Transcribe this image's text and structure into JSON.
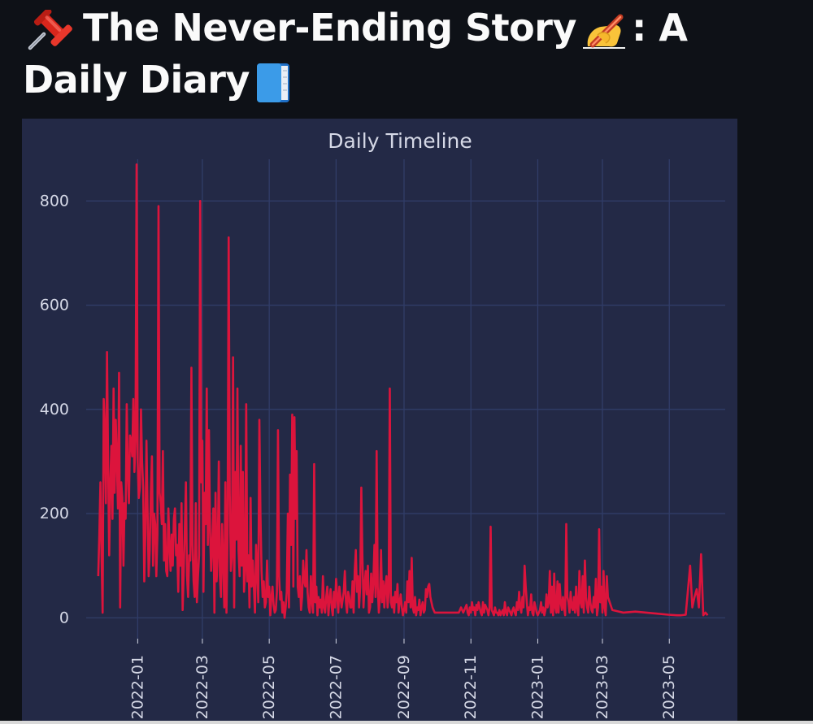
{
  "page": {
    "title_part1": "The Never-Ending Story",
    "title_part2": ": A",
    "title_part3": "Daily Diary",
    "icons": [
      "pushpin-icon",
      "writing-hand-icon",
      "blue-book-icon"
    ]
  },
  "chart_data": {
    "type": "line",
    "title": "Daily Timeline",
    "xlabel": "",
    "ylabel": "",
    "color": "#dc143c",
    "grid": true,
    "background": "#232946",
    "gridcolor": "#313d68",
    "ylim": [
      -40,
      880
    ],
    "xlim": [
      "2021-11-15",
      "2023-06-21"
    ],
    "yticks": [
      0,
      200,
      400,
      600,
      800
    ],
    "xticks": [
      "2022-01",
      "2022-03",
      "2022-05",
      "2022-07",
      "2022-09",
      "2022-11",
      "2023-01",
      "2023-03",
      "2023-05"
    ],
    "x": [
      "2021-11-26",
      "2021-11-27",
      "2021-11-28",
      "2021-11-29",
      "2021-11-30",
      "2021-12-01",
      "2021-12-02",
      "2021-12-03",
      "2021-12-04",
      "2021-12-05",
      "2021-12-06",
      "2021-12-07",
      "2021-12-08",
      "2021-12-09",
      "2021-12-10",
      "2021-12-11",
      "2021-12-12",
      "2021-12-13",
      "2021-12-14",
      "2021-12-15",
      "2021-12-16",
      "2021-12-17",
      "2021-12-18",
      "2021-12-19",
      "2021-12-20",
      "2021-12-21",
      "2021-12-22",
      "2021-12-23",
      "2021-12-24",
      "2021-12-25",
      "2021-12-26",
      "2021-12-27",
      "2021-12-28",
      "2021-12-29",
      "2021-12-30",
      "2021-12-31",
      "2022-01-01",
      "2022-01-02",
      "2022-01-03",
      "2022-01-04",
      "2022-01-05",
      "2022-01-06",
      "2022-01-07",
      "2022-01-08",
      "2022-01-09",
      "2022-01-10",
      "2022-01-11",
      "2022-01-12",
      "2022-01-13",
      "2022-01-14",
      "2022-01-15",
      "2022-01-16",
      "2022-01-17",
      "2022-01-18",
      "2022-01-19",
      "2022-01-20",
      "2022-01-21",
      "2022-01-22",
      "2022-01-23",
      "2022-01-24",
      "2022-01-25",
      "2022-01-26",
      "2022-01-27",
      "2022-01-28",
      "2022-01-29",
      "2022-01-30",
      "2022-01-31",
      "2022-02-01",
      "2022-02-02",
      "2022-02-03",
      "2022-02-04",
      "2022-02-05",
      "2022-02-06",
      "2022-02-07",
      "2022-02-08",
      "2022-02-09",
      "2022-02-10",
      "2022-02-11",
      "2022-02-12",
      "2022-02-13",
      "2022-02-14",
      "2022-02-15",
      "2022-02-16",
      "2022-02-17",
      "2022-02-18",
      "2022-02-19",
      "2022-02-20",
      "2022-02-21",
      "2022-02-22",
      "2022-02-23",
      "2022-02-24",
      "2022-02-25",
      "2022-02-26",
      "2022-02-27",
      "2022-02-28",
      "2022-03-01",
      "2022-03-02",
      "2022-03-03",
      "2022-03-04",
      "2022-03-05",
      "2022-03-06",
      "2022-03-07",
      "2022-03-08",
      "2022-03-09",
      "2022-03-10",
      "2022-03-11",
      "2022-03-12",
      "2022-03-13",
      "2022-03-14",
      "2022-03-15",
      "2022-03-16",
      "2022-03-17",
      "2022-03-18",
      "2022-03-19",
      "2022-03-20",
      "2022-03-21",
      "2022-03-22",
      "2022-03-23",
      "2022-03-24",
      "2022-03-25",
      "2022-03-26",
      "2022-03-27",
      "2022-03-28",
      "2022-03-29",
      "2022-03-30",
      "2022-03-31",
      "2022-04-01",
      "2022-04-02",
      "2022-04-03",
      "2022-04-04",
      "2022-04-05",
      "2022-04-06",
      "2022-04-07",
      "2022-04-08",
      "2022-04-09",
      "2022-04-10",
      "2022-04-11",
      "2022-04-12",
      "2022-04-13",
      "2022-04-14",
      "2022-04-15",
      "2022-04-16",
      "2022-04-17",
      "2022-04-18",
      "2022-04-19",
      "2022-04-20",
      "2022-04-21",
      "2022-04-22",
      "2022-04-23",
      "2022-04-24",
      "2022-04-25",
      "2022-04-26",
      "2022-04-27",
      "2022-04-28",
      "2022-04-29",
      "2022-04-30",
      "2022-05-01",
      "2022-05-02",
      "2022-05-03",
      "2022-05-04",
      "2022-05-05",
      "2022-05-06",
      "2022-05-07",
      "2022-05-08",
      "2022-05-09",
      "2022-05-10",
      "2022-05-11",
      "2022-05-12",
      "2022-05-13",
      "2022-05-14",
      "2022-05-15",
      "2022-05-16",
      "2022-05-17",
      "2022-05-18",
      "2022-05-19",
      "2022-05-20",
      "2022-05-21",
      "2022-05-22",
      "2022-05-23",
      "2022-05-24",
      "2022-05-25",
      "2022-05-26",
      "2022-05-27",
      "2022-05-28",
      "2022-05-29",
      "2022-05-30",
      "2022-05-31",
      "2022-06-01",
      "2022-06-02",
      "2022-06-03",
      "2022-06-04",
      "2022-06-05",
      "2022-06-06",
      "2022-06-07",
      "2022-06-08",
      "2022-06-09",
      "2022-06-10",
      "2022-06-11",
      "2022-06-12",
      "2022-06-13",
      "2022-06-14",
      "2022-06-15",
      "2022-06-16",
      "2022-06-17",
      "2022-06-18",
      "2022-06-19",
      "2022-06-20",
      "2022-06-21",
      "2022-06-22",
      "2022-06-23",
      "2022-06-24",
      "2022-06-25",
      "2022-06-26",
      "2022-06-27",
      "2022-06-28",
      "2022-06-29",
      "2022-06-30",
      "2022-07-01",
      "2022-07-02",
      "2022-07-03",
      "2022-07-04",
      "2022-07-05",
      "2022-07-06",
      "2022-07-07",
      "2022-07-08",
      "2022-07-09",
      "2022-07-10",
      "2022-07-11",
      "2022-07-12",
      "2022-07-13",
      "2022-07-14",
      "2022-07-15",
      "2022-07-16",
      "2022-07-17",
      "2022-07-18",
      "2022-07-19",
      "2022-07-20",
      "2022-07-21",
      "2022-07-22",
      "2022-07-23",
      "2022-07-24",
      "2022-07-25",
      "2022-07-26",
      "2022-07-27",
      "2022-07-28",
      "2022-07-29",
      "2022-07-30",
      "2022-07-31",
      "2022-08-01",
      "2022-08-02",
      "2022-08-03",
      "2022-08-04",
      "2022-08-05",
      "2022-08-06",
      "2022-08-07",
      "2022-08-08",
      "2022-08-09",
      "2022-08-10",
      "2022-08-11",
      "2022-08-12",
      "2022-08-13",
      "2022-08-14",
      "2022-08-15",
      "2022-08-16",
      "2022-08-17",
      "2022-08-18",
      "2022-08-19",
      "2022-08-20",
      "2022-08-21",
      "2022-08-22",
      "2022-08-23",
      "2022-08-24",
      "2022-08-25",
      "2022-08-26",
      "2022-08-27",
      "2022-08-28",
      "2022-08-29",
      "2022-08-30",
      "2022-08-31",
      "2022-09-01",
      "2022-09-02",
      "2022-09-03",
      "2022-09-04",
      "2022-09-05",
      "2022-09-06",
      "2022-09-07",
      "2022-09-08",
      "2022-09-09",
      "2022-09-10",
      "2022-09-11",
      "2022-09-12",
      "2022-09-13",
      "2022-09-14",
      "2022-09-15",
      "2022-09-16",
      "2022-09-17",
      "2022-09-18",
      "2022-09-19",
      "2022-09-20",
      "2022-09-21",
      "2022-09-22",
      "2022-09-23",
      "2022-09-24",
      "2022-09-25",
      "2022-09-26",
      "2022-09-27",
      "2022-09-28",
      "2022-09-29",
      "2022-09-30",
      "2022-10-01",
      "2022-10-02",
      "2022-10-03",
      "2022-10-04",
      "2022-10-05",
      "2022-10-06",
      "2022-10-07",
      "2022-10-08",
      "2022-10-09",
      "2022-10-10",
      "2022-10-11",
      "2022-10-12",
      "2022-10-13",
      "2022-10-14",
      "2022-10-15",
      "2022-10-16",
      "2022-10-17",
      "2022-10-18",
      "2022-10-19",
      "2022-10-20",
      "2022-10-21",
      "2022-10-22",
      "2022-10-23",
      "2022-10-24",
      "2022-10-25",
      "2022-10-26",
      "2022-10-27",
      "2022-10-28",
      "2022-10-29",
      "2022-10-30",
      "2022-10-31",
      "2022-11-01",
      "2022-11-02",
      "2022-11-03",
      "2022-11-04",
      "2022-11-05",
      "2022-11-06",
      "2022-11-07",
      "2022-11-08",
      "2022-11-09",
      "2022-11-10",
      "2022-11-11",
      "2022-11-12",
      "2022-11-13",
      "2022-11-14",
      "2022-11-15",
      "2022-11-16",
      "2022-11-17",
      "2022-11-18",
      "2022-11-19",
      "2022-11-20",
      "2022-11-21",
      "2022-11-22",
      "2022-11-23",
      "2022-11-24",
      "2022-11-25",
      "2022-11-26",
      "2022-11-27",
      "2022-11-28",
      "2022-11-29",
      "2022-11-30",
      "2022-12-01",
      "2022-12-02",
      "2022-12-03",
      "2022-12-04",
      "2022-12-05",
      "2022-12-06",
      "2022-12-07",
      "2022-12-08",
      "2022-12-09",
      "2022-12-10",
      "2022-12-11",
      "2022-12-12",
      "2022-12-13",
      "2022-12-14",
      "2022-12-15",
      "2022-12-16",
      "2022-12-17",
      "2022-12-18",
      "2022-12-19",
      "2022-12-20",
      "2022-12-21",
      "2022-12-22",
      "2022-12-23",
      "2022-12-24",
      "2022-12-25",
      "2022-12-26",
      "2022-12-27",
      "2022-12-28",
      "2022-12-29",
      "2022-12-30",
      "2022-12-31",
      "2023-01-01",
      "2023-01-02",
      "2023-01-03",
      "2023-01-04",
      "2023-01-05",
      "2023-01-06",
      "2023-01-07",
      "2023-01-08",
      "2023-01-09",
      "2023-01-10",
      "2023-01-11",
      "2023-01-12",
      "2023-01-13",
      "2023-01-14",
      "2023-01-15",
      "2023-01-16",
      "2023-01-17",
      "2023-01-18",
      "2023-01-19",
      "2023-01-20",
      "2023-01-21",
      "2023-01-22",
      "2023-01-23",
      "2023-01-24",
      "2023-01-25",
      "2023-01-26",
      "2023-01-27",
      "2023-01-28",
      "2023-01-29",
      "2023-01-30",
      "2023-01-31",
      "2023-02-01",
      "2023-02-02",
      "2023-02-03",
      "2023-02-04",
      "2023-02-05",
      "2023-02-06",
      "2023-02-07",
      "2023-02-08",
      "2023-02-09",
      "2023-02-10",
      "2023-02-11",
      "2023-02-12",
      "2023-02-13",
      "2023-02-14",
      "2023-02-15",
      "2023-02-16",
      "2023-02-17",
      "2023-02-18",
      "2023-02-19",
      "2023-02-20",
      "2023-02-21",
      "2023-02-22",
      "2023-02-23",
      "2023-02-24",
      "2023-02-25",
      "2023-02-26",
      "2023-02-27",
      "2023-02-28",
      "2023-03-01",
      "2023-03-02",
      "2023-03-03",
      "2023-03-04",
      "2023-03-05",
      "2023-03-06",
      "2023-03-10",
      "2023-03-20",
      "2023-03-31",
      "2023-04-10",
      "2023-04-20",
      "2023-04-30",
      "2023-05-08",
      "2023-05-12",
      "2023-05-16",
      "2023-05-20",
      "2023-05-22",
      "2023-05-24",
      "2023-05-26",
      "2023-05-28",
      "2023-05-30",
      "2023-06-01",
      "2023-06-03",
      "2023-06-05"
    ],
    "series": [
      {
        "values": [
          80,
          160,
          260,
          120,
          10,
          420,
          360,
          220,
          510,
          300,
          120,
          260,
          330,
          190,
          440,
          240,
          380,
          300,
          210,
          470,
          20,
          260,
          230,
          100,
          220,
          190,
          410,
          280,
          220,
          350,
          340,
          310,
          420,
          280,
          340,
          870,
          300,
          230,
          250,
          400,
          300,
          250,
          70,
          160,
          340,
          210,
          80,
          130,
          240,
          310,
          100,
          200,
          180,
          80,
          160,
          790,
          240,
          220,
          180,
          320,
          110,
          180,
          90,
          80,
          210,
          140,
          90,
          160,
          100,
          190,
          210,
          120,
          140,
          50,
          180,
          100,
          220,
          15,
          90,
          170,
          260,
          80,
          40,
          120,
          110,
          480,
          140,
          70,
          40,
          220,
          30,
          80,
          120,
          800,
          260,
          340,
          50,
          240,
          180,
          440,
          140,
          360,
          170,
          90,
          140,
          210,
          10,
          240,
          70,
          120,
          300,
          80,
          40,
          180,
          110,
          20,
          260,
          10,
          160,
          730,
          240,
          90,
          120,
          500,
          20,
          280,
          150,
          440,
          130,
          80,
          330,
          100,
          280,
          50,
          90,
          410,
          70,
          120,
          20,
          230,
          60,
          110,
          60,
          10,
          140,
          90,
          30,
          380,
          200,
          90,
          40,
          70,
          20,
          30,
          110,
          40,
          60,
          5,
          40,
          60,
          25,
          10,
          15,
          50,
          360,
          80,
          35,
          50,
          10,
          30,
          0,
          20,
          50,
          200,
          20,
          275,
          140,
          390,
          60,
          385,
          190,
          320,
          60,
          40,
          80,
          15,
          40,
          110,
          70,
          60,
          130,
          50,
          20,
          10,
          80,
          30,
          10,
          295,
          30,
          60,
          5,
          40,
          20,
          35,
          10,
          80,
          20,
          10,
          40,
          60,
          5,
          35,
          55,
          20,
          5,
          50,
          20,
          75,
          40,
          10,
          60,
          40,
          20,
          35,
          50,
          90,
          30,
          10,
          50,
          40,
          20,
          20,
          70,
          10,
          90,
          130,
          50,
          80,
          20,
          60,
          250,
          120,
          20,
          60,
          90,
          45,
          100,
          10,
          20,
          85,
          30,
          70,
          140,
          40,
          320,
          60,
          10,
          40,
          130,
          30,
          70,
          20,
          60,
          80,
          20,
          50,
          440,
          30,
          20,
          40,
          10,
          50,
          30,
          65,
          10,
          30,
          45,
          20,
          5,
          15,
          30,
          10,
          70,
          30,
          90,
          20,
          115,
          20,
          10,
          40,
          5,
          20,
          15,
          35,
          5,
          20,
          30,
          10,
          15,
          55,
          40,
          60,
          65,
          40,
          30,
          20,
          15,
          10,
          10,
          10,
          10,
          10,
          10,
          10,
          10,
          10,
          10,
          10,
          10,
          10,
          10,
          10,
          10,
          10,
          10,
          10,
          10,
          10,
          10,
          10,
          15,
          20,
          15,
          10,
          15,
          20,
          25,
          10,
          5,
          20,
          10,
          30,
          15,
          20,
          5,
          25,
          15,
          30,
          20,
          10,
          5,
          30,
          10,
          25,
          20,
          15,
          5,
          20,
          175,
          15,
          10,
          5,
          20,
          10,
          10,
          5,
          15,
          5,
          10,
          15,
          5,
          30,
          10,
          5,
          20,
          15,
          10,
          5,
          15,
          20,
          10,
          5,
          30,
          15,
          50,
          20,
          10,
          40,
          20,
          100,
          60,
          30,
          5,
          20,
          15,
          45,
          10,
          5,
          30,
          20,
          10,
          5,
          10,
          15,
          30,
          10,
          20,
          5,
          15,
          45,
          20,
          30,
          90,
          10,
          60,
          5,
          85,
          20,
          10,
          70,
          10,
          65,
          30,
          15,
          40,
          20,
          5,
          180,
          40,
          30,
          10,
          50,
          20,
          15,
          40,
          10,
          60,
          20,
          5,
          90,
          30,
          20,
          80,
          10,
          110,
          40,
          20,
          10,
          60,
          30,
          15,
          10,
          40,
          20,
          75,
          5,
          20,
          170,
          30,
          60,
          10,
          90,
          20,
          5,
          80,
          40,
          15,
          10,
          12,
          10,
          8,
          6,
          5,
          5,
          6,
          100,
          20,
          40,
          55,
          20,
          122,
          5,
          10,
          5,
          5,
          15
        ]
      }
    ]
  }
}
